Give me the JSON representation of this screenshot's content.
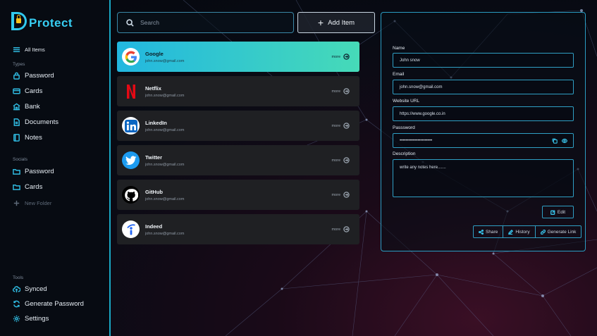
{
  "app": {
    "logo_text": "Protect"
  },
  "sidebar": {
    "all_items": "All Items",
    "types_label": "Types",
    "types": [
      {
        "label": "Password",
        "icon": "lock-icon"
      },
      {
        "label": "Cards",
        "icon": "credit-card-icon"
      },
      {
        "label": "Bank",
        "icon": "bank-icon"
      },
      {
        "label": "Documents",
        "icon": "document-icon"
      },
      {
        "label": "Notes",
        "icon": "notebook-icon"
      }
    ],
    "socials_label": "Socials",
    "socials": [
      {
        "label": "Password",
        "icon": "folder-icon"
      },
      {
        "label": "Cards",
        "icon": "folder-icon"
      }
    ],
    "new_folder": "New Folder",
    "tools_label": "Tools",
    "tools": [
      {
        "label": "Synced",
        "icon": "cloud-upload-icon"
      },
      {
        "label": "Generate Password",
        "icon": "refresh-icon"
      },
      {
        "label": "Settings",
        "icon": "gear-icon"
      }
    ]
  },
  "search": {
    "placeholder": "Search"
  },
  "add_item_label": "Add Item",
  "items": [
    {
      "name": "Google",
      "email": "john.snow@gmail.com",
      "more": "more",
      "icon": "google-icon"
    },
    {
      "name": "Netflix",
      "email": "john.snow@gmail.com",
      "more": "more",
      "icon": "netflix-icon"
    },
    {
      "name": "LinkedIn",
      "email": "john.snow@gmail.com",
      "more": "more",
      "icon": "linkedin-icon"
    },
    {
      "name": "Twitter",
      "email": "john.snow@gmail.com",
      "more": "more",
      "icon": "twitter-icon"
    },
    {
      "name": "GitHub",
      "email": "john.snow@gmail.com",
      "more": "more",
      "icon": "github-icon"
    },
    {
      "name": "Indeed",
      "email": "john.snow@gmail.com",
      "more": "more",
      "icon": "indeed-icon"
    }
  ],
  "detail": {
    "name_label": "Name",
    "name_value": "John snow",
    "email_label": "Email",
    "email_value": "john.snow@gmail.com",
    "website_label": "Website URL",
    "website_value": "https://www.google.co.in",
    "password_label": "Passsword",
    "password_value": "••••••••••••••••••••••",
    "description_label": "Description",
    "description_value": "write any notes here.......",
    "edit_label": "Edit",
    "share_label": "Share",
    "history_label": "History",
    "generate_link_label": "Generate Link"
  },
  "colors": {
    "accent": "#2fb9df",
    "active_gradient_start": "#22b7e0",
    "active_gradient_end": "#46dab8",
    "lock": "#f6c11a"
  }
}
